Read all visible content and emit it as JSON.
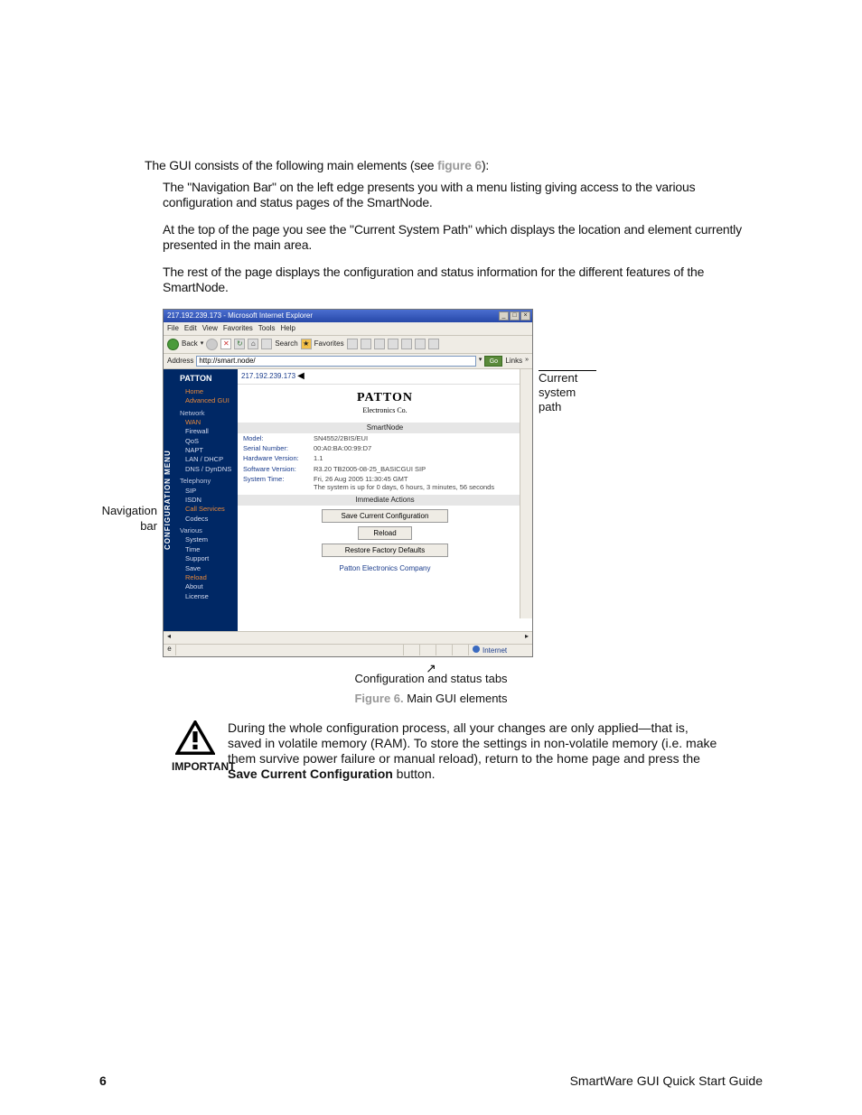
{
  "body": {
    "intro_a": "The GUI consists of the following main elements (see ",
    "figref": "figure 6",
    "intro_b": "):",
    "p1": "The \"Navigation Bar\" on the left edge presents you with a menu listing giving access to the various configuration and status pages of the SmartNode.",
    "p2": "At the top of the page you see the \"Current System Path\" which displays the location and element currently presented in the main area.",
    "p3": "The rest of the page displays the configuration and status information for the different features of the SmartNode."
  },
  "callouts": {
    "left1": "Navigation",
    "left2": "bar",
    "right1": "Current",
    "right2": "system path",
    "bottom": "Configuration and status tabs"
  },
  "browser": {
    "title": "217.192.239.173 - Microsoft Internet Explorer",
    "menus": [
      "File",
      "Edit",
      "View",
      "Favorites",
      "Tools",
      "Help"
    ],
    "toolbar": {
      "back": "Back",
      "search": "Search",
      "favorites": "Favorites"
    },
    "address_label": "Address",
    "address_value": "http://smart.node/",
    "go": "Go",
    "links": "Links"
  },
  "nav": {
    "vlabel": "CONFIGURATION MENU",
    "brand": "PATTON",
    "brandsub": "Electronics Co.",
    "items": [
      {
        "label": "Home",
        "cls": "i hl"
      },
      {
        "label": "Advanced GUI",
        "cls": "i hl"
      },
      {
        "label": "Network",
        "cls": "h"
      },
      {
        "label": "WAN",
        "cls": "i hl"
      },
      {
        "label": "Firewall",
        "cls": "i"
      },
      {
        "label": "QoS",
        "cls": "i"
      },
      {
        "label": "NAPT",
        "cls": "i"
      },
      {
        "label": "LAN / DHCP",
        "cls": "i"
      },
      {
        "label": "DNS / DynDNS",
        "cls": "i"
      },
      {
        "label": "Telephony",
        "cls": "h"
      },
      {
        "label": "SIP",
        "cls": "i"
      },
      {
        "label": "ISDN",
        "cls": "i"
      },
      {
        "label": "Call Services",
        "cls": "i hl"
      },
      {
        "label": "Codecs",
        "cls": "i"
      },
      {
        "label": "Various",
        "cls": "h"
      },
      {
        "label": "System",
        "cls": "i"
      },
      {
        "label": "Time",
        "cls": "i"
      },
      {
        "label": "Support",
        "cls": "i"
      },
      {
        "label": "Save",
        "cls": "i"
      },
      {
        "label": "Reload",
        "cls": "i hl"
      },
      {
        "label": "About",
        "cls": "i"
      },
      {
        "label": "License",
        "cls": "i"
      }
    ]
  },
  "main": {
    "crumb": "217.192.239.173",
    "logo1": "PATTON",
    "logo2": "Electronics Co.",
    "section1": "SmartNode",
    "rows": [
      {
        "k": "Model:",
        "v": "SN4552/2BIS/EUI"
      },
      {
        "k": "Serial Number:",
        "v": "00:A0:BA:00:99:D7"
      },
      {
        "k": "Hardware Version:",
        "v": "1.1"
      },
      {
        "k": "Software Version:",
        "v": "R3.20 TB2005-08-25_BASICGUI SIP"
      },
      {
        "k": "System Time:",
        "v": "Fri, 26 Aug 2005 11:30:45 GMT\nThe system is up for 0 days, 6 hours, 3 minutes, 56 seconds"
      }
    ],
    "section2": "Immediate Actions",
    "btn1": "Save Current Configuration",
    "btn2": "Reload",
    "btn3": "Restore Factory Defaults",
    "company": "Patton Electronics Company",
    "status_zone": "Internet"
  },
  "figcap": {
    "label": "Figure 6.",
    "text": " Main GUI elements"
  },
  "note": {
    "label": "IMPORTANT",
    "text_a": "During the whole configuration process, all your changes are only applied—that is, saved in volatile memory (RAM). To store the settings in non-volatile memory (i.e. make them survive power failure or manual reload), return to the home page and press the ",
    "bold": "Save Current Configuration",
    "text_b": " button."
  },
  "footer": {
    "page": "6",
    "doc": "SmartWare GUI Quick Start Guide"
  }
}
